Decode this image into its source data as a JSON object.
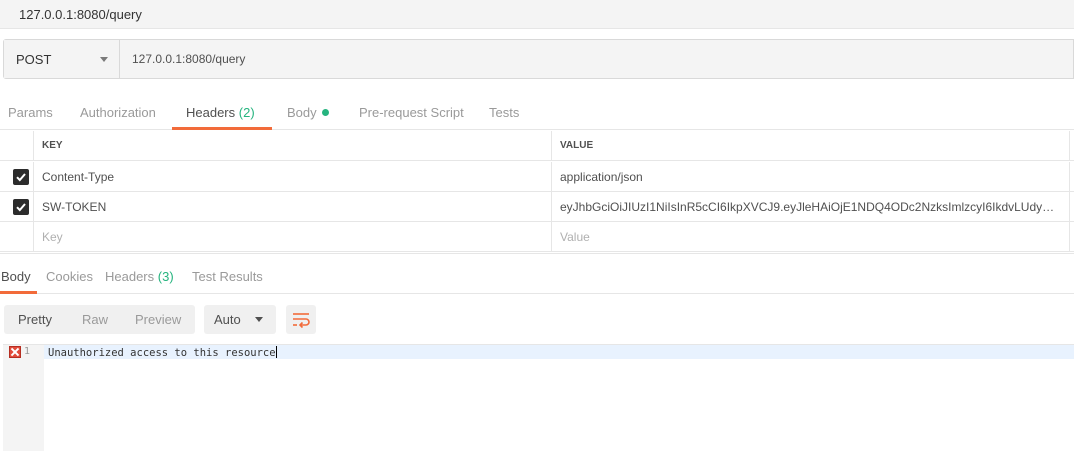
{
  "window": {
    "title": "127.0.0.1:8080/query"
  },
  "request": {
    "method": "POST",
    "url": "127.0.0.1:8080/query"
  },
  "request_tabs": {
    "params": "Params",
    "authorization": "Authorization",
    "headers": "Headers",
    "headers_count": "(2)",
    "body": "Body",
    "prerequest": "Pre-request Script",
    "tests": "Tests",
    "active": "Headers"
  },
  "headers_table": {
    "key_header": "KEY",
    "value_header": "VALUE",
    "rows": [
      {
        "checked": true,
        "key": "Content-Type",
        "value": "application/json"
      },
      {
        "checked": true,
        "key": "SW-TOKEN",
        "value": "eyJhbGciOiJIUzI1NiIsInR5cCI6IkpXVCJ9.eyJleHAiOjE1NDQ4ODc2NzksImlzcyI6IkdvLUdyYX..."
      }
    ],
    "placeholder_key": "Key",
    "placeholder_value": "Value"
  },
  "response_tabs": {
    "body": "Body",
    "cookies": "Cookies",
    "headers": "Headers",
    "headers_count": "(3)",
    "test_results": "Test Results",
    "active": "Body"
  },
  "format": {
    "pretty": "Pretty",
    "raw": "Raw",
    "preview": "Preview",
    "active": "Pretty",
    "mode": "Auto",
    "wrap_icon": "wrap-lines-icon"
  },
  "editor": {
    "line_number": "1",
    "content": "Unauthorized access to this resource",
    "error_icon": "error-marker-icon"
  },
  "colors": {
    "accent": "#f26b3a",
    "count": "#26b47f",
    "error": "#e14b3b"
  }
}
